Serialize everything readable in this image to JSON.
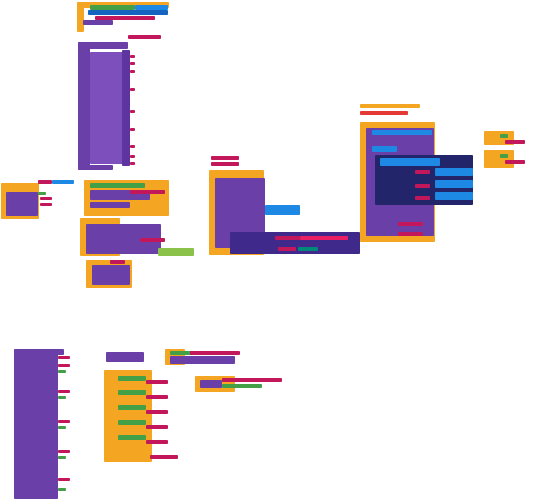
{
  "workspace": {
    "background": "#ffffff",
    "block_colors": {
      "control_orange": "#f4a623",
      "procedure_purple": "#6a3fa8",
      "text_pink": "#c2185b",
      "logic_green": "#43a047",
      "component_blue": "#1e88e5",
      "math_teal": "#00897b",
      "light_green": "#8bc34a",
      "red": "#e53935",
      "gray": "#9e9e9e",
      "dark_navy": "#23256b"
    }
  }
}
